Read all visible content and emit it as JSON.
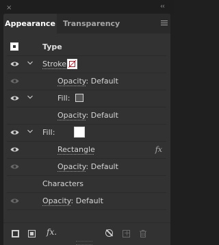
{
  "window": {
    "close_glyph": "×",
    "collapse_glyph": "‹‹"
  },
  "tabs": [
    {
      "label": "Appearance",
      "active": true
    },
    {
      "label": "Transparency",
      "active": false
    }
  ],
  "rows": {
    "type": {
      "label": "Type"
    },
    "stroke": {
      "label": "Stroke:"
    },
    "stroke_opacity": {
      "key": "Opacity",
      "value": ": Default"
    },
    "fill1": {
      "label": "Fill:"
    },
    "fill1_opacity": {
      "key": "Opacity",
      "value": ": Default"
    },
    "fill2": {
      "label": "Fill:"
    },
    "rectangle": {
      "label": "Rectangle",
      "fx": "fx"
    },
    "fill2_opacity": {
      "key": "Opacity",
      "value": ": Default"
    },
    "characters": {
      "label": "Characters"
    },
    "opacity": {
      "key": "Opacity",
      "value": ": Default"
    }
  },
  "toolbar": {
    "fx": "fx."
  },
  "colors": {
    "panel_bg": "#323232",
    "stroke_swatch_accent": "#c0182a",
    "fill1_swatch": "#555555",
    "fill2_swatch": "#ffffff"
  },
  "icons": [
    "close-icon",
    "collapse-icon",
    "panel-menu-icon",
    "eye-icon",
    "chevron-down-icon",
    "add-stroke-icon",
    "add-fill-icon",
    "fx-icon",
    "clear-appearance-icon",
    "duplicate-icon",
    "trash-icon"
  ]
}
